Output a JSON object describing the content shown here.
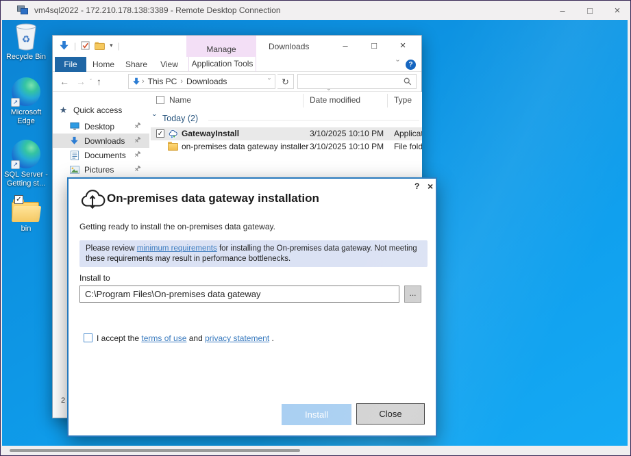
{
  "rdp": {
    "title": "vm4sql2022 - 172.210.178.138:3389 - Remote Desktop Connection",
    "controls": {
      "minimize": "–",
      "maximize": "□",
      "close": "×"
    }
  },
  "desktop": {
    "icons": [
      {
        "label": "Recycle Bin"
      },
      {
        "label": "Microsoft Edge"
      },
      {
        "label": "SQL Server - Getting st..."
      },
      {
        "label": "bin"
      }
    ]
  },
  "explorer": {
    "window_title": "Downloads",
    "manage_tab": "Manage",
    "controls": {
      "minimize": "–",
      "maximize": "□",
      "close": "×"
    },
    "tabs": {
      "file": "File",
      "home": "Home",
      "share": "Share",
      "view": "View",
      "app_tools": "Application Tools"
    },
    "nav": {
      "back": "←",
      "forward": "→",
      "up": "↑",
      "refresh": "↻",
      "chevron": "ˇ",
      "qat_chevron": "▾"
    },
    "breadcrumb": {
      "sep": "›",
      "items": [
        "This PC",
        "Downloads"
      ]
    },
    "columns": {
      "name": "Name",
      "date": "Date modified",
      "type": "Type",
      "sort_caret": "ˇ"
    },
    "group": {
      "chevron": "ˇ",
      "label": "Today (2)"
    },
    "files": [
      {
        "name": "GatewayInstall",
        "date": "3/10/2025 10:10 PM",
        "type": "Applicatio",
        "check": "✓"
      },
      {
        "name": "on-premises data gateway installer",
        "date": "3/10/2025 10:10 PM",
        "type": "File folder",
        "check": ""
      }
    ],
    "sidebar": {
      "star": "★",
      "items": [
        {
          "label": "Quick access"
        },
        {
          "label": "Desktop"
        },
        {
          "label": "Downloads"
        },
        {
          "label": "Documents"
        },
        {
          "label": "Pictures"
        }
      ]
    },
    "status_count": "2"
  },
  "dialog": {
    "help": "?",
    "close": "×",
    "title": "On-premises data gateway installation",
    "subtitle": "Getting ready to install the on-premises data gateway.",
    "notice": {
      "pre": "Please review ",
      "link": "minimum requirements",
      "post": " for installing the On-premises data gateway. Not meeting these requirements may result in performance bottlenecks."
    },
    "install_to_label": "Install to",
    "install_path": "C:\\Program Files\\On-premises data gateway",
    "browse_label": "...",
    "accept": {
      "pre": "I accept the ",
      "link1": "terms of use",
      "mid": " and ",
      "link2": "privacy statement",
      "post": " ."
    },
    "install_button": "Install",
    "close_button": "Close"
  },
  "colors": {
    "desktop_blue": "#0d93e2",
    "accent_blue": "#2b7cd3",
    "dialog_border": "#2779bd",
    "notice_bg": "#dbe2f4",
    "install_disabled_bg": "#a9cff2",
    "file_tab_bg": "#1f66a5",
    "manage_tab_bg": "#f3dff6",
    "selected_row_bg": "#e9e9e9"
  }
}
